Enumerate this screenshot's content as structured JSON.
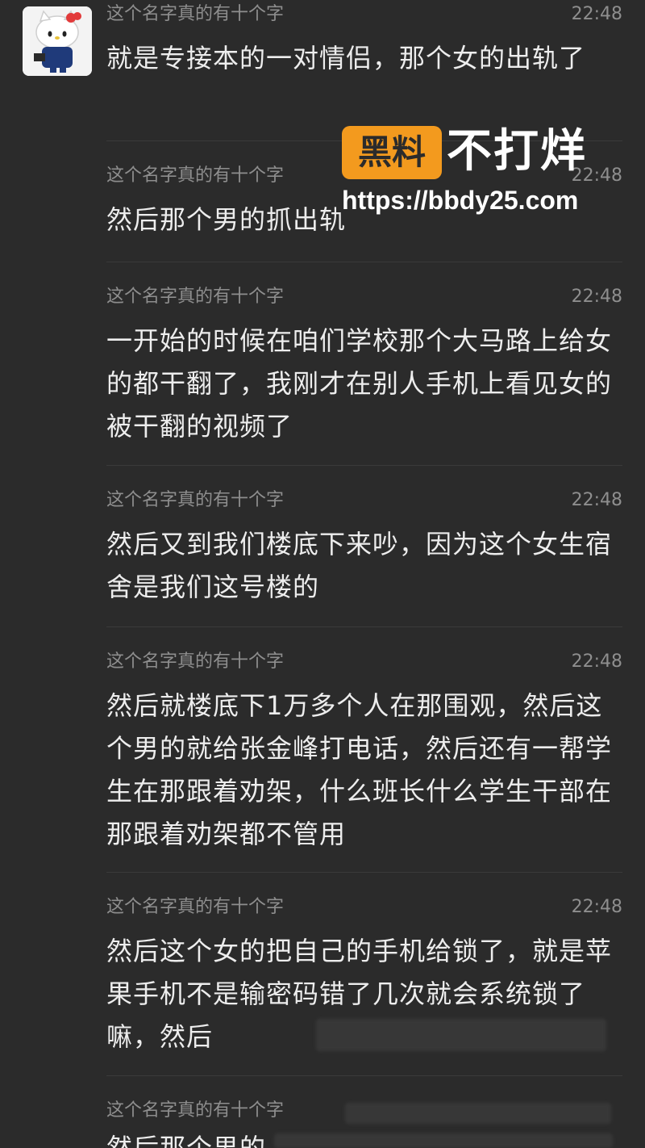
{
  "sender_name": "这个名字真的有十个字",
  "watermark": {
    "badge": "黑料",
    "title": "不打烊",
    "url": "https://bbdy25.com"
  },
  "messages": [
    {
      "time": "22:48",
      "text": "就是专接本的一对情侣，那个女的出轨了"
    },
    {
      "time": "22:48",
      "text": "然后那个男的抓出轨"
    },
    {
      "time": "22:48",
      "text": "一开始的时候在咱们学校那个大马路上给女的都干翻了，我刚才在别人手机上看见女的被干翻的视频了"
    },
    {
      "time": "22:48",
      "text": "然后又到我们楼底下来吵，因为这个女生宿舍是我们这号楼的"
    },
    {
      "time": "22:48",
      "text": "然后就楼底下1万多个人在那围观，然后这个男的就给张金峰打电话，然后还有一帮学生在那跟着劝架，什么班长什么学生干部在那跟着劝架都不管用"
    },
    {
      "time": "22:48",
      "text": "然后这个女的把自己的手机给锁了，就是苹果手机不是输密码错了几次就会系统锁了嘛，然后"
    },
    {
      "time": "",
      "text": "然后那个男的"
    }
  ]
}
